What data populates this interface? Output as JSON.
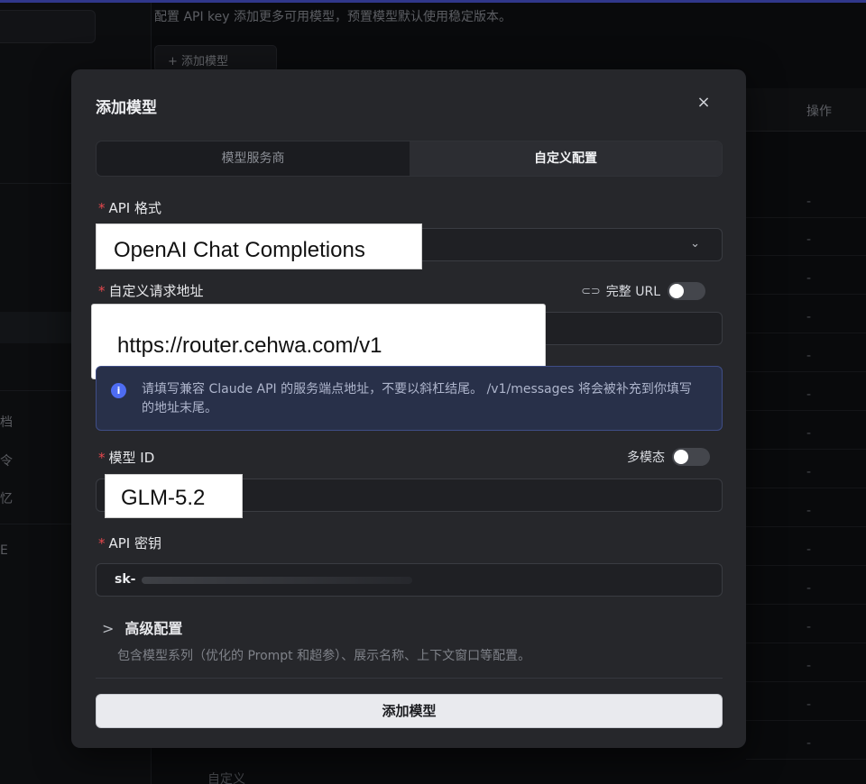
{
  "background": {
    "description": "配置 API key 添加更多可用模型，预置模型默认使用稳定版本。",
    "add_button": "+ 添加模型",
    "column_header": "操作",
    "row_placeholder": "-",
    "sidebar_fragments": [
      "档",
      "令",
      "忆",
      "E"
    ],
    "bottom_item": "自定义"
  },
  "modal": {
    "title": "添加模型",
    "close_label": "×",
    "tabs": [
      {
        "label": "模型服务商",
        "active": false
      },
      {
        "label": "自定义配置",
        "active": true
      }
    ],
    "api_format": {
      "label": "API 格式",
      "value": "OpenAI Chat Completions",
      "chevron": "⌄"
    },
    "endpoint": {
      "label": "自定义请求地址",
      "full_url_label": "完整 URL",
      "full_url_on": false,
      "value": "https://router.cehwa.com/v1"
    },
    "info": {
      "text": "请填写兼容 Claude API 的服务端点地址，不要以斜杠结尾。 /v1/messages 将会被补充到你填写的地址末尾。"
    },
    "model_id": {
      "label": "模型 ID",
      "multimodal_label": "多模态",
      "multimodal_on": false,
      "value": "GLM-5.2"
    },
    "api_key": {
      "label": "API 密钥",
      "value": "sk-"
    },
    "advanced": {
      "title": "高级配置",
      "chevron": ">",
      "description": "包含模型系列（优化的 Prompt 和超参）、展示名称、上下文窗口等配置。"
    },
    "submit_label": "添加模型"
  },
  "colors": {
    "modal_bg": "#26272b",
    "required": "#e5484d",
    "info_bg": "#283049",
    "info_accent": "#4e6cf2"
  }
}
